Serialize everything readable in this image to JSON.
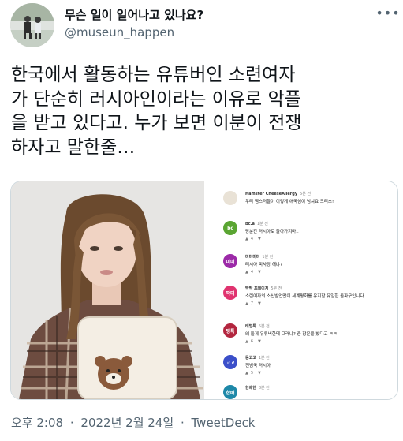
{
  "header": {
    "display_name": "무슨 일이 일어나고 있나요?",
    "handle": "@museun_happen",
    "more_label": "•••"
  },
  "tweet": {
    "text_lines": [
      "한국에서 활동하는 유튜버인 소련여자",
      "가 단순히 러시아인이라는 이유로 악플",
      "을 받고 있다고. 누가 보면 이분이 전쟁",
      "하자고 말한줄…"
    ]
  },
  "comments": [
    {
      "name": "Hamster CheeseAllergy",
      "time": "5분 전",
      "text": "우리 햄스터들이 이렇게 애국심이 넘쳐요 크리스!",
      "likes": "",
      "avatar_text": "",
      "avatar_color": "#e9e2d6"
    },
    {
      "name": "bc.a",
      "time": "1분 전",
      "text": "당분간 러시아로 돌아가지마..",
      "likes": "4",
      "avatar_text": "bc",
      "avatar_color": "#5aa532"
    },
    {
      "name": "미미미미",
      "time": "1분 전",
      "text": "러시아 피사랑 해냐?",
      "likes": "4",
      "avatar_text": "미미",
      "avatar_color": "#9c2aa8"
    },
    {
      "name": "딱딱 프레이지",
      "time": "5분 전",
      "text": "소련여자의 소신발언만이 세계평화를 유지할 유일한 돌파구입니다.",
      "likes": "7",
      "avatar_text": "딱터",
      "avatar_color": "#e0336f"
    },
    {
      "name": "태멍톡",
      "time": "5분 전",
      "text": "왜 둘게 유튜버한테 그러냐? 중 항문을 봤다고 ㅋㅋ",
      "likes": "6",
      "avatar_text": "탱톡",
      "avatar_color": "#b3263f"
    },
    {
      "name": "둥고고",
      "time": "1분 전",
      "text": "전범국 러시아",
      "likes": "5",
      "avatar_text": "고고",
      "avatar_color": "#3b4fc9"
    },
    {
      "name": "한배한",
      "time": "8분 전",
      "text": "",
      "likes": "",
      "avatar_text": "한배",
      "avatar_color": "#1e88a8"
    }
  ],
  "footer": {
    "time": "오후 2:08",
    "separator": "·",
    "date": "2022년 2월 24일",
    "source": "TweetDeck"
  },
  "colors": {
    "text_primary": "#0f1419",
    "text_secondary": "#536471",
    "border": "#cfd9de"
  },
  "icons": [
    "more-options-icon",
    "like-icon",
    "dislike-icon"
  ]
}
